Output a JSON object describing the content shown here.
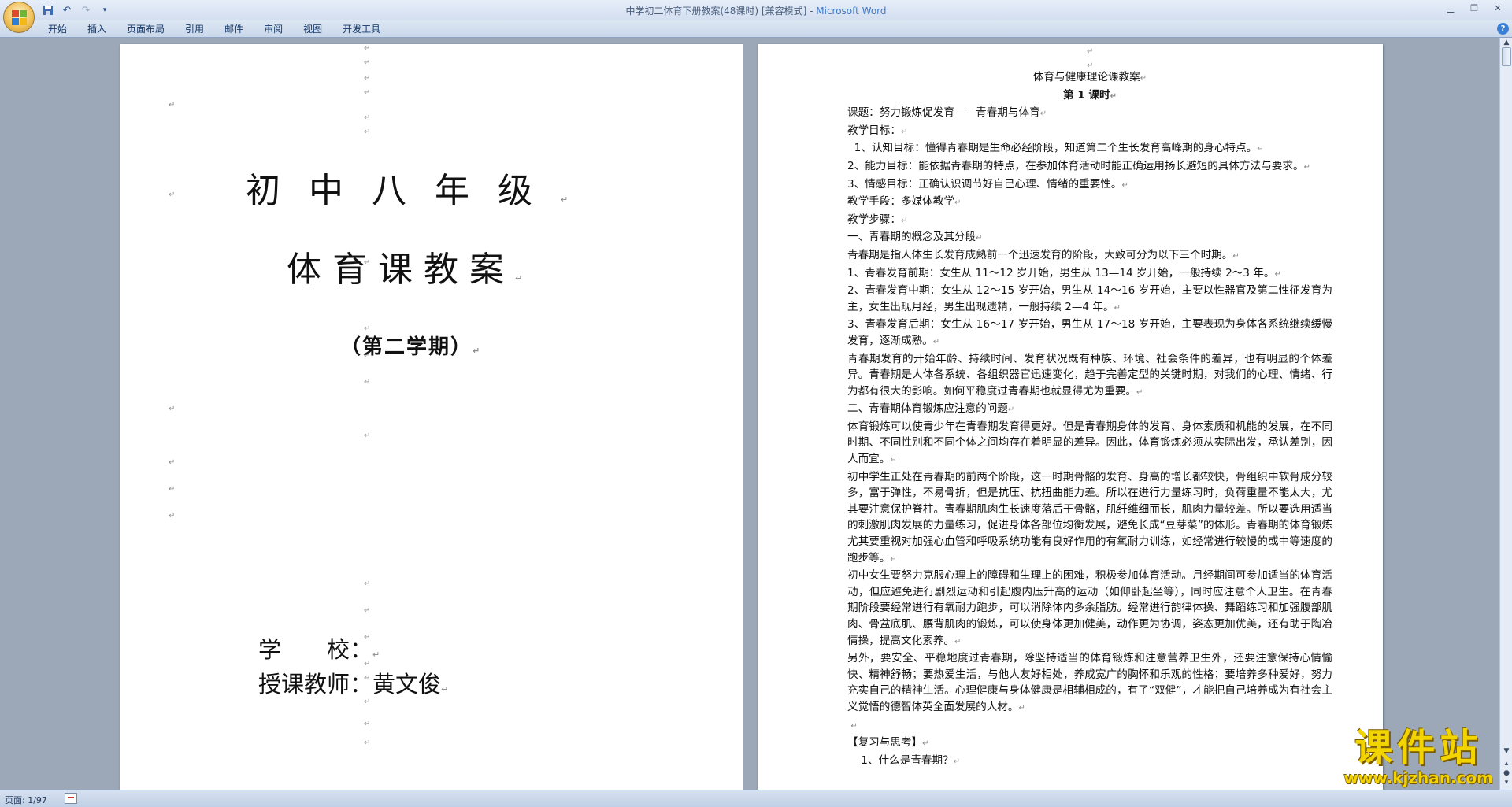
{
  "window": {
    "title_doc": "中学初二体育下册教案(48课时) [兼容模式] - ",
    "title_app": "Microsoft Word"
  },
  "quick_access": {
    "save_icon": "save-icon",
    "undo_icon": "undo-icon",
    "redo_icon": "redo-icon",
    "customize_icon": "dropdown-icon"
  },
  "ribbon": {
    "tabs": [
      "开始",
      "插入",
      "页面布局",
      "引用",
      "邮件",
      "审阅",
      "视图",
      "开发工具"
    ],
    "help": "?"
  },
  "cover": {
    "grade": "初中八年级",
    "title": "体育课教案",
    "term": "（第二学期）",
    "school_label": "学　　校：",
    "teacher_label": "授课教师：黄文俊"
  },
  "lesson": {
    "heading": "体育与健康理论课教案",
    "session": "第 1 课时",
    "lines": [
      {
        "text": "课题：努力锻炼促发育——青春期与体育",
        "cls": ""
      },
      {
        "text": "教学目标：",
        "cls": ""
      },
      {
        "text": "  1、认知目标：懂得青春期是生命必经阶段，知道第二个生长发育高峰期的身心特点。",
        "cls": ""
      },
      {
        "text": "2、能力目标：能依据青春期的特点，在参加体育活动时能正确运用扬长避短的具体方法与要求。",
        "cls": ""
      },
      {
        "text": "3、情感目标：正确认识调节好自己心理、情绪的重要性。",
        "cls": ""
      },
      {
        "text": "教学手段：多媒体教学",
        "cls": ""
      },
      {
        "text": "教学步骤：",
        "cls": ""
      },
      {
        "text": "一、青春期的概念及其分段",
        "cls": ""
      },
      {
        "text": "青春期是指人体生长发育成熟前一个迅速发育的阶段，大致可分为以下三个时期。",
        "cls": ""
      },
      {
        "text": "1、青春发育前期：女生从 11～12 岁开始，男生从 13—14 岁开始，一般持续 2～3 年。",
        "cls": ""
      },
      {
        "text": "2、青春发育中期：女生从 12～15 岁开始，男生从 14～16 岁开始，主要以性器官及第二性征发育为主，女生出现月经，男生出现遗精，一般持续 2—4 年。",
        "cls": ""
      },
      {
        "text": "3、青春发育后期：女生从 16～17 岁开始，男生从 17～18 岁开始，主要表现为身体各系统继续缓慢发育，逐渐成熟。",
        "cls": ""
      },
      {
        "text": "青春期发育的开始年龄、持续时间、发育状况既有种族、环境、社会条件的差异，也有明显的个体差异。青春期是人体各系统、各组织器官迅速变化，趋于完善定型的关键时期，对我们的心理、情绪、行为都有很大的影响。如何平稳度过青春期也就显得尤为重要。",
        "cls": ""
      },
      {
        "text": "二、青春期体育锻炼应注意的问题",
        "cls": ""
      },
      {
        "text": "体育锻炼可以使青少年在青春期发育得更好。但是青春期身体的发育、身体素质和机能的发展，在不同时期、不同性别和不同个体之间均存在着明显的差异。因此，体育锻炼必须从实际出发，承认差别，因人而宜。",
        "cls": ""
      },
      {
        "text": "初中学生正处在青春期的前两个阶段，这一时期骨骼的发育、身高的增长都较快，骨组织中软骨成分较多，富于弹性，不易骨折，但是抗压、抗扭曲能力差。所以在进行力量练习时，负荷重量不能太大，尤其要注意保护脊柱。青春期肌肉生长速度落后于骨骼，肌纤维细而长，肌肉力量较差。所以要选用适当的刺激肌肉发展的力量练习，促进身体各部位均衡发展，避免长成“豆芽菜”的体形。青春期的体育锻炼尤其要重视对加强心血管和呼吸系统功能有良好作用的有氧耐力训练，如经常进行较慢的或中等速度的跑步等。",
        "cls": ""
      },
      {
        "text": "初中女生要努力克服心理上的障碍和生理上的困难，积极参加体育活动。月经期间可参加适当的体育活动，但应避免进行剧烈运动和引起腹内压升高的运动（如仰卧起坐等），同时应注意个人卫生。在青春期阶段要经常进行有氧耐力跑步，可以消除体内多余脂肪。经常进行韵律体操、舞蹈练习和加强腹部肌肉、骨盆底肌、腰背肌肉的锻炼，可以使身体更加健美，动作更为协调，姿态更加优美，还有助于陶冶情操，提高文化素养。",
        "cls": ""
      },
      {
        "text": "另外，要安全、平稳地度过青春期，除坚持适当的体育锻炼和注意营养卫生外，还要注意保持心情愉快、精神舒畅；要热爱生活，与他人友好相处，养成宽广的胸怀和乐观的性格；要培养多种爱好，努力充实自己的精神生活。心理健康与身体健康是相辅相成的，有了“双健”，才能把自己培养成为有社会主义觉悟的德智体英全面发展的人材。",
        "cls": ""
      },
      {
        "text": " ",
        "cls": ""
      },
      {
        "text": "【复习与思考】",
        "cls": ""
      },
      {
        "text": "    1、什么是青春期？",
        "cls": ""
      }
    ]
  },
  "status": {
    "page": "页面: 1/97"
  },
  "watermark": {
    "title": "课件站",
    "url": "www.kjzhan.com"
  }
}
